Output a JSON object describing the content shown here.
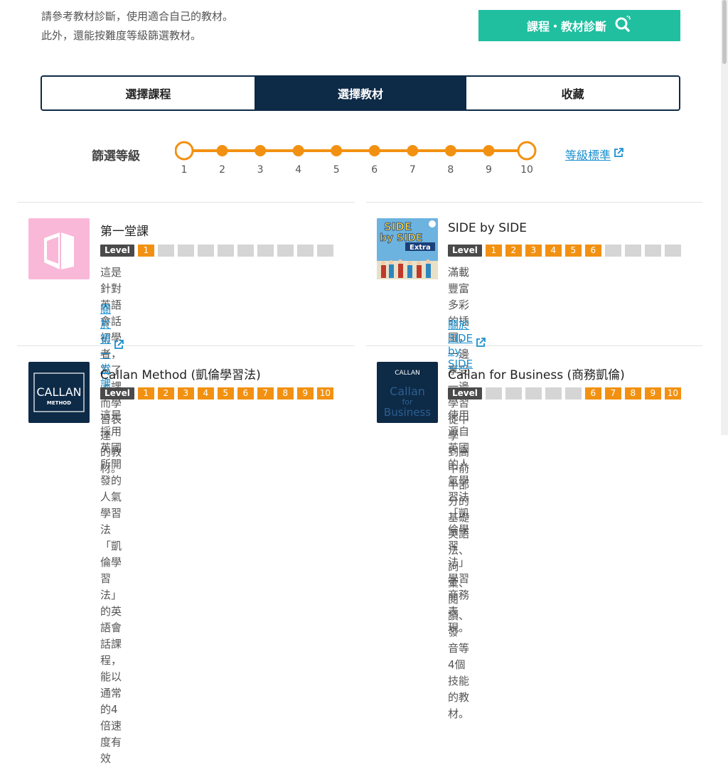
{
  "intro": {
    "line1": "請參考教材診斷，使用適合自己的教材。",
    "line2": "此外，還能按難度等級篩選教材。"
  },
  "diagnosis_button": {
    "label": "課程・教材診斷",
    "icon": "search-icon"
  },
  "tabs": [
    {
      "label": "選擇課程",
      "active": false
    },
    {
      "label": "選擇教材",
      "active": true
    },
    {
      "label": "收藏",
      "active": false
    }
  ],
  "filter": {
    "label": "篩選等級",
    "levels": [
      "1",
      "2",
      "3",
      "4",
      "5",
      "6",
      "7",
      "8",
      "9",
      "10"
    ],
    "selected_min": 1,
    "selected_max": 10,
    "grade_link": "等級標準",
    "accent": "#f29111"
  },
  "level_tag": "Level",
  "cards": [
    {
      "title": "第一堂課",
      "levels": [
        1
      ],
      "desc1": "這是針對英語會話初學者，為了上課而學習表達",
      "desc2": "的教材。",
      "desc3": "",
      "link": "關於第一堂課"
    },
    {
      "title": "SIDE by SIDE",
      "cover_text1": "SIDE",
      "cover_text2": "by SIDE",
      "cover_text3": "Extra",
      "levels": [
        1,
        2,
        3,
        4,
        5,
        6
      ],
      "desc1": "滿載豐富多彩的插圖，一邊享受一邊學習從中學",
      "desc2": "到高中前半部分的基礎英語法、詞彙、閱讀、發",
      "desc3": "音等4個技能的教材。",
      "link": "關於SIDE by SIDE"
    },
    {
      "title": "Callan Method (凱倫學習法)",
      "cover_text1": "CALLAN",
      "cover_text2": "METHOD",
      "levels": [
        1,
        2,
        3,
        4,
        5,
        6,
        7,
        8,
        9,
        10
      ],
      "desc1": "這是採用英國所開發的人氣學習法「凱倫學習",
      "desc2": "法」的英語會話課程，能以通常的4倍速度有效",
      "desc3": "",
      "link": ""
    },
    {
      "title": "Callan for Business (商務凱倫)",
      "cover_text1": "CALLAN",
      "cover_text2": "Callan",
      "cover_text3": "for",
      "cover_text4": "Business",
      "levels": [
        6,
        7,
        8,
        9,
        10
      ],
      "desc1": "使用源自英國的人氣學習法「凱倫學習法」學習",
      "desc2": "商務表現。",
      "desc3": "",
      "link": ""
    }
  ],
  "colors": {
    "teal": "#1fbfa0",
    "navy": "#0d2a47",
    "orange": "#f29111",
    "link": "#1a8fcf"
  }
}
